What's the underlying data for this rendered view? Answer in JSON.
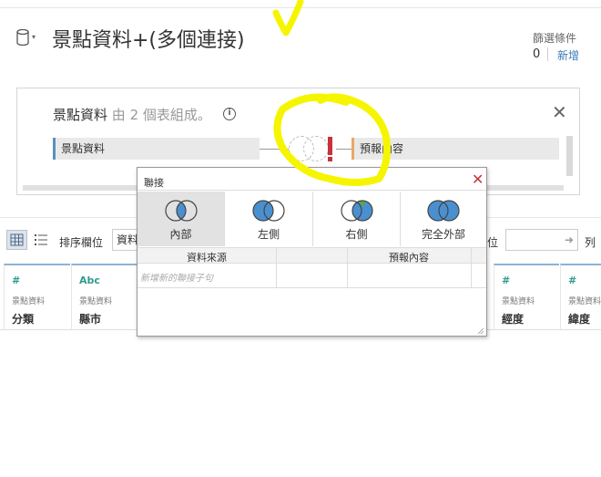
{
  "header": {
    "title": "景點資料+(多個連接)",
    "filter_label": "篩選條件",
    "filter_count": "0",
    "filter_add": "新增"
  },
  "join_panel": {
    "title": "景點資料",
    "subtitle": "由 2 個表組成。",
    "info_icon_text": "i",
    "left_table": "景點資料",
    "right_table": "預報內容"
  },
  "toolbar": {
    "sort_label": "排序欄位",
    "sort_value": "資料",
    "position_label": "位",
    "column_label": "列"
  },
  "columns": [
    {
      "type": "#",
      "source": "景點資料",
      "name": "分類"
    },
    {
      "type": "Abc",
      "source": "景點資料",
      "name": "縣市"
    },
    {
      "type": "#",
      "source": "景點資料",
      "name": "經度"
    },
    {
      "type": "#",
      "source": "景點資料",
      "name": "緯度"
    }
  ],
  "dialog": {
    "title": "聯接",
    "join_types": [
      {
        "label": "內部",
        "icon": "inner-join-icon",
        "selected": true
      },
      {
        "label": "左側",
        "icon": "left-join-icon",
        "selected": false
      },
      {
        "label": "右側",
        "icon": "right-join-icon",
        "selected": false
      },
      {
        "label": "完全外部",
        "icon": "full-outer-join-icon",
        "selected": false
      }
    ],
    "table_headers": {
      "source": "資料來源",
      "target": "預報內容"
    },
    "add_clause": "新增新的聯接子句"
  },
  "colors": {
    "accent_blue": "#3a7ab8",
    "venn_blue": "#4a90d0",
    "venn_green": "#5aa83a",
    "warning_red": "#c8323c",
    "annotation_yellow": "#f5f500"
  }
}
